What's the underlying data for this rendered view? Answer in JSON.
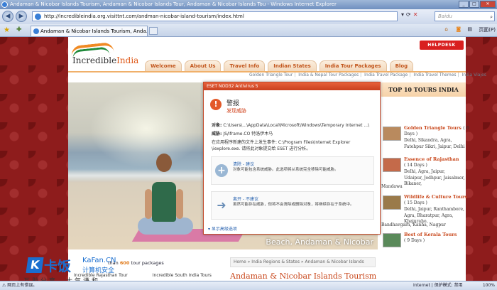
{
  "window": {
    "title": "Andaman & Nicobar Islands Tourism, Andaman & Nicobar Islands Tour, Andaman & Nicobar Islands Tou - Windows Internet Explorer",
    "controls": [
      "_",
      "□",
      "✕"
    ]
  },
  "address_bar": {
    "url": "http://incredibleindia.org.visittnt.com/andman-nicobar-island-tourism/index.html",
    "search_placeholder": "Baidu"
  },
  "tab_bar": {
    "active_tab": "Andaman & Nicobar Islands Tourism, Anda...",
    "page_menu": "页面(P)"
  },
  "site": {
    "logo_text_1": "Incredible",
    "logo_text_2": "India",
    "helpdesk": "HELPDESK",
    "nav": [
      "Welcome",
      "About Us",
      "Travel Info",
      "Indian States",
      "India Tour Packages",
      "Blog"
    ],
    "subnav": [
      "Golden Triangle Tour",
      "India & Nepal Tour Packages",
      "India Travel Package",
      "India Travel Themes",
      "India Viajes"
    ],
    "hero_caption": "Beach, Andaman & Nicobar",
    "top10_title": "TOP 10 TOURS INDIA",
    "tours": [
      {
        "name": "Golden Triangle Tours",
        "days_prefix": "( 6",
        "days_suffix": "Days )",
        "places": "Delhi, Sikandra, Agra, Fatehpur Sikri, Jaipur, Delhi"
      },
      {
        "name": "Essence of Rajasthan",
        "days": "( 14 Days )",
        "places": "Delhi, Agra, Jaipur, Udaipur, Jodhpur, Jaisalmer, Bikaner,",
        "extra": "Mandawa"
      },
      {
        "name": "Wildlife & Culture Tours",
        "days": "( 15 Days )",
        "places": "Delhi, Jaipur, Ranthambore, Agra, Bharatpur, Agra, Khajuraho,",
        "extra": "Bandhavgarh, Kanha, Nagpur"
      },
      {
        "name": "Best of Kerala Tours",
        "days": "( 9 Days )"
      }
    ],
    "breadcrumb": "Home » India Regions & States » Andaman & Nicobar Islands",
    "page_heading": "Andaman & Nicobar Islands Tourism",
    "promo_prefix": "than",
    "promo_count": "600",
    "promo_suffix": "tour packages",
    "links": [
      "Incredible Rajasthan Tour",
      "Incredible South India Tours"
    ]
  },
  "eset": {
    "window_title": "ESET NOD32 Antivirus 5",
    "alert_title": "警报",
    "alert_subtitle": "发现威胁",
    "object_label": "对象:",
    "object_value": "C:\\Users\\...\\AppData\\Local\\Microsoft\\Windows\\Temporary Internet ...\\",
    "threat_label": "威胁:",
    "threat_value": "JS/Iframe.CO 特洛伊木马",
    "desc_1": "在应用程序新建的文件上发生事件: C:\\Program Files\\Internet Explorer",
    "desc_2": "\\iexplore.exe. 请将此对象提交给 ESET 进行分析。",
    "option_clean_title": "清除 - 建议",
    "option_clean_desc": "对象可能包含系统威胁。此选项将从系统完全移除可能威胁。",
    "option_ignore_title": "离开 - 不建议",
    "option_ignore_desc": "虽然可能存在威胁，但将不会清除或删除对象，将继续存在于系统中。",
    "advanced": "显示高级选项"
  },
  "watermark": {
    "big": "卡饭",
    "brand": "KaFan.CN",
    "subtitle": "计算机安全",
    "slogan": "互助分享　大气谦和"
  },
  "status_bar": {
    "left": "网页上有错误。",
    "zone": "Internet | 保护模式: 禁用",
    "zoom": "100%"
  }
}
